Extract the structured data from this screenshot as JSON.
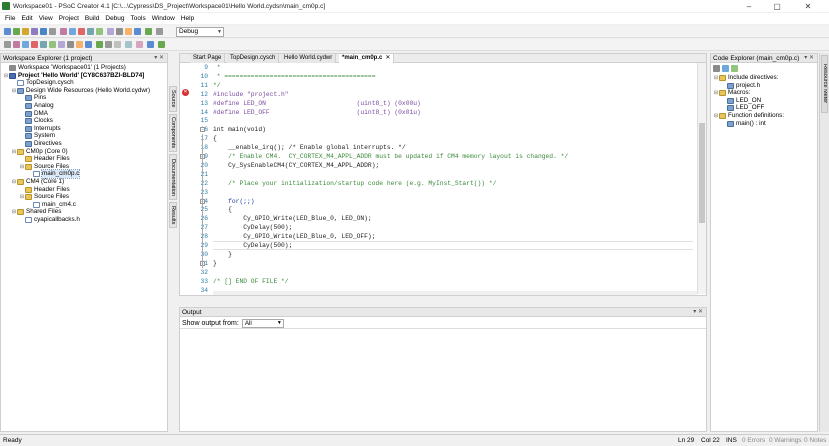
{
  "window": {
    "title": "Workspace01 - PSoC Creator 4.1  [C:\\...\\Cypress\\DS_Project\\Workspace01\\Hello World.cydsn\\main_cm0p.c]",
    "minimize": "–",
    "maximize": "▢",
    "close": "✕"
  },
  "menu": [
    "File",
    "Edit",
    "View",
    "Project",
    "Build",
    "Debug",
    "Tools",
    "Window",
    "Help"
  ],
  "toolbar": {
    "config_value": "Debug"
  },
  "workspace_explorer": {
    "title": "Workspace Explorer (1 project)",
    "pin": "▾ ✕",
    "tree": [
      {
        "label": "Workspace 'Workspace01' (1 Projects)",
        "icon": "workspace-icon",
        "depth": 0,
        "toggle": "",
        "kind": "ws"
      },
      {
        "label": "Project 'Hello World' [CY8C637BZI-BLD74]",
        "icon": "project-icon",
        "depth": 0,
        "toggle": "⊟",
        "kind": "proj",
        "bold": true
      },
      {
        "label": "TopDesign.cysch",
        "icon": "schematic-file-icon",
        "depth": 1,
        "toggle": "",
        "kind": "file"
      },
      {
        "label": "Design Wide Resources (Hello World.cydwr)",
        "icon": "resources-icon",
        "depth": 1,
        "toggle": "⊟",
        "kind": "item"
      },
      {
        "label": "Pins",
        "icon": "pins-icon",
        "depth": 2,
        "toggle": "",
        "kind": "item"
      },
      {
        "label": "Analog",
        "icon": "analog-icon",
        "depth": 2,
        "toggle": "",
        "kind": "item"
      },
      {
        "label": "DMA",
        "icon": "dma-icon",
        "depth": 2,
        "toggle": "",
        "kind": "item"
      },
      {
        "label": "Clocks",
        "icon": "clocks-icon",
        "depth": 2,
        "toggle": "",
        "kind": "item"
      },
      {
        "label": "Interrupts",
        "icon": "interrupts-icon",
        "depth": 2,
        "toggle": "",
        "kind": "item"
      },
      {
        "label": "System",
        "icon": "system-icon",
        "depth": 2,
        "toggle": "",
        "kind": "item"
      },
      {
        "label": "Directives",
        "icon": "directives-icon",
        "depth": 2,
        "toggle": "",
        "kind": "item"
      },
      {
        "label": "CM0p (Core 0)",
        "icon": "folder-icon",
        "depth": 1,
        "toggle": "⊟",
        "kind": "folder"
      },
      {
        "label": "Header Files",
        "icon": "folder-icon",
        "depth": 2,
        "toggle": "",
        "kind": "folder"
      },
      {
        "label": "Source Files",
        "icon": "folder-icon",
        "depth": 2,
        "toggle": "⊟",
        "kind": "folder"
      },
      {
        "label": "main_cm0p.c",
        "icon": "c-file-icon",
        "depth": 3,
        "toggle": "",
        "kind": "file",
        "selected": true
      },
      {
        "label": "CM4 (Core 1)",
        "icon": "folder-icon",
        "depth": 1,
        "toggle": "⊟",
        "kind": "folder"
      },
      {
        "label": "Header Files",
        "icon": "folder-icon",
        "depth": 2,
        "toggle": "",
        "kind": "folder"
      },
      {
        "label": "Source Files",
        "icon": "folder-icon",
        "depth": 2,
        "toggle": "⊟",
        "kind": "folder"
      },
      {
        "label": "main_cm4.c",
        "icon": "c-file-icon",
        "depth": 3,
        "toggle": "",
        "kind": "file"
      },
      {
        "label": "Shared Files",
        "icon": "folder-icon",
        "depth": 1,
        "toggle": "⊟",
        "kind": "folder"
      },
      {
        "label": "cyapicallbacks.h",
        "icon": "h-file-icon",
        "depth": 2,
        "toggle": "",
        "kind": "file"
      }
    ]
  },
  "side_tabs": [
    "Source",
    "Components",
    "Documentation",
    "Results"
  ],
  "editor": {
    "tabs": [
      "Start Page",
      "TopDesign.cysch",
      "Hello World.cydwr",
      "*main_cm0p.c"
    ],
    "active_tab": 3,
    "close": "✕",
    "lines": [
      {
        "n": "9",
        "text": " *",
        "cls": "cmt"
      },
      {
        "n": "10",
        "text": " * ========================================",
        "cls": "cmt"
      },
      {
        "n": "11",
        "text": "*/",
        "cls": "cmt"
      },
      {
        "n": "12",
        "text": "#include \"project.h\"",
        "cls": "pp"
      },
      {
        "n": "13",
        "text": "#define LED_ON                        (uint8_t) (0x00u)",
        "cls": "pp"
      },
      {
        "n": "14",
        "text": "#define LED_OFF                       (uint8_t) (0x01u)",
        "cls": "pp"
      },
      {
        "n": "15",
        "text": "",
        "cls": ""
      },
      {
        "n": "16",
        "text": "int main(void)",
        "cls": ""
      },
      {
        "n": "17",
        "text": "{",
        "cls": ""
      },
      {
        "n": "18",
        "text": "    __enable_irq(); /* Enable global interrupts. */",
        "cls": ""
      },
      {
        "n": "19",
        "text": "    /* Enable CM4.  CY_CORTEX_M4_APPL_ADDR must be updated if CM4 memory layout is changed. */",
        "cls": "cmt"
      },
      {
        "n": "20",
        "text": "    Cy_SysEnableCM4(CY_CORTEX_M4_APPL_ADDR);",
        "cls": ""
      },
      {
        "n": "21",
        "text": "",
        "cls": ""
      },
      {
        "n": "22",
        "text": "    /* Place your initialization/startup code here (e.g. MyInst_Start()) */",
        "cls": "cmt"
      },
      {
        "n": "23",
        "text": "",
        "cls": ""
      },
      {
        "n": "24",
        "text": "    for(;;)",
        "cls": "kw"
      },
      {
        "n": "25",
        "text": "    {",
        "cls": ""
      },
      {
        "n": "26",
        "text": "        Cy_GPIO_Write(LED_Blue_0, LED_ON);",
        "cls": ""
      },
      {
        "n": "27",
        "text": "        CyDelay(500);",
        "cls": ""
      },
      {
        "n": "28",
        "text": "        Cy_GPIO_Write(LED_Blue_0, LED_OFF);",
        "cls": ""
      },
      {
        "n": "29",
        "text": "        CyDelay(500);",
        "cls": ""
      },
      {
        "n": "30",
        "text": "    }",
        "cls": ""
      },
      {
        "n": "31",
        "text": "}",
        "cls": ""
      },
      {
        "n": "32",
        "text": "",
        "cls": ""
      },
      {
        "n": "33",
        "text": "/* [] END OF FILE */",
        "cls": "cmt"
      },
      {
        "n": "34",
        "text": "",
        "cls": ""
      }
    ],
    "current_line": 29
  },
  "output": {
    "title": "Output",
    "show_label": "Show output from:",
    "show_value": "All"
  },
  "code_explorer": {
    "title": "Code Explorer (main_cm0p.c)",
    "tree": [
      {
        "label": "Include directives:",
        "toggle": "⊟",
        "depth": 0
      },
      {
        "label": "project.h",
        "toggle": "",
        "depth": 1
      },
      {
        "label": "Macros:",
        "toggle": "⊟",
        "depth": 0
      },
      {
        "label": "LED_ON",
        "toggle": "",
        "depth": 1
      },
      {
        "label": "LED_OFF",
        "toggle": "",
        "depth": 1
      },
      {
        "label": "Function definitions:",
        "toggle": "⊟",
        "depth": 0
      },
      {
        "label": "main() : int",
        "toggle": "",
        "depth": 1
      }
    ],
    "side_tab": "Resource Meter"
  },
  "status": {
    "ready": "Ready",
    "line": "Ln 29",
    "col": "Col 22",
    "ins": "INS",
    "errors": "0 Errors",
    "warnings": "0 Warnings",
    "notes": "0 Notes"
  }
}
